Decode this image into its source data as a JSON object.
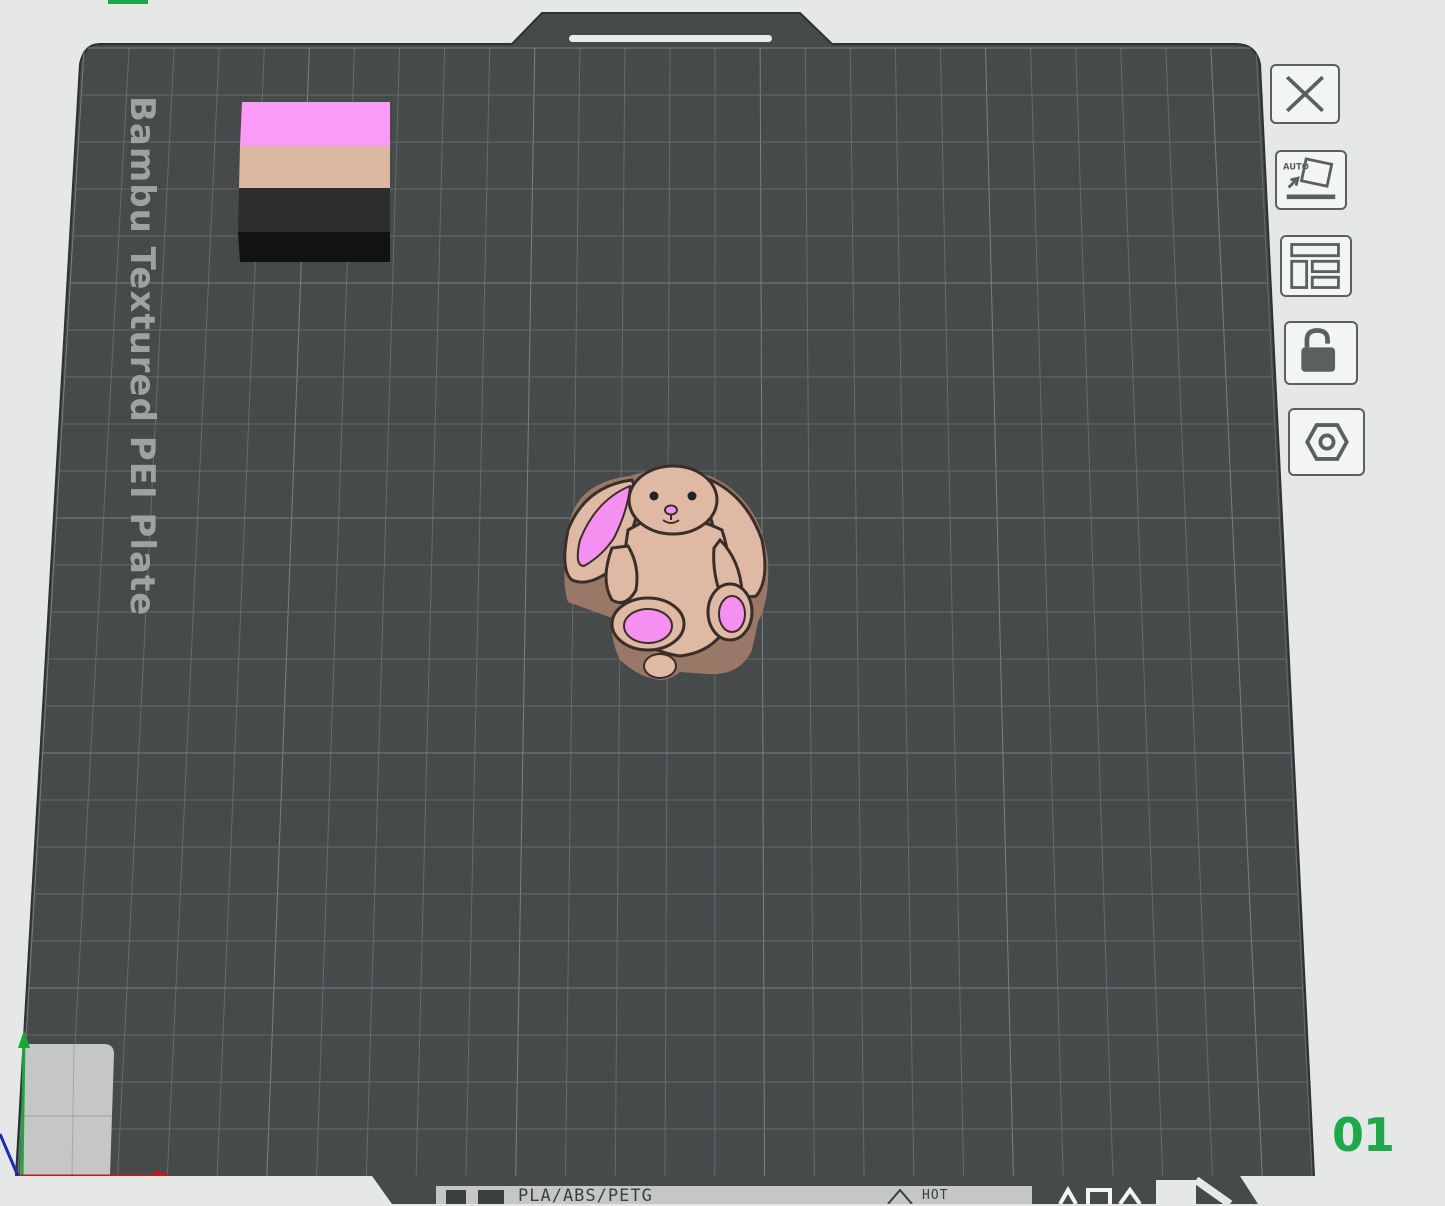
{
  "plate": {
    "label": "Bambu Textured PEI Plate",
    "number": "01",
    "strip_left_text": "PLA/ABS/PETG",
    "strip_right_text": "HOT"
  },
  "side_toolbar": [
    {
      "name": "close",
      "icon": "close-icon"
    },
    {
      "name": "auto-orient",
      "icon": "auto-orient-icon",
      "badge": "AUTO"
    },
    {
      "name": "arrange",
      "icon": "arrange-icon"
    },
    {
      "name": "lock",
      "icon": "unlock-icon"
    },
    {
      "name": "settings",
      "icon": "nut-settings-icon"
    }
  ],
  "colors": {
    "plate": "#474a4b",
    "grid": "#6a6e6f",
    "accent_green": "#1fa84a",
    "filament_pink": "#f79af3",
    "filament_tan": "#dfb9a4",
    "filament_black": "#2b2c2c"
  }
}
